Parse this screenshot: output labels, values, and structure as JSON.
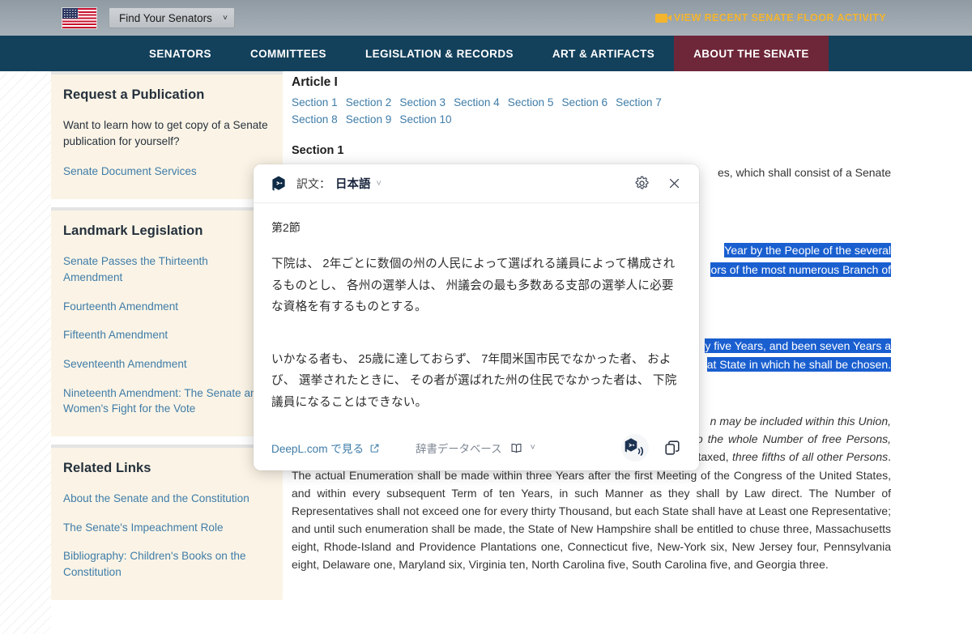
{
  "topbar": {
    "flag_icon": "us-flag-icon",
    "senator_select": {
      "label": "Find Your Senators",
      "chevron": "˅"
    },
    "floor_activity": {
      "label": "VIEW RECENT SENATE FLOOR ACTIVITY",
      "icon": "video-camera-icon"
    }
  },
  "nav": {
    "items": [
      {
        "label": "SENATORS",
        "active": false
      },
      {
        "label": "COMMITTEES",
        "active": false
      },
      {
        "label": "LEGISLATION & RECORDS",
        "active": false
      },
      {
        "label": "ART & ARTIFACTS",
        "active": false
      },
      {
        "label": "ABOUT THE SENATE",
        "active": true
      }
    ],
    "active_color": "#6e2639",
    "bar_color": "#13415c"
  },
  "sidebar": {
    "panels": [
      {
        "title": "Request a Publication",
        "text": "Want to learn how to get copy of a Senate publication for yourself?",
        "links": [
          "Senate Document Services"
        ]
      },
      {
        "title": "Landmark Legislation",
        "links": [
          "Senate Passes the Thirteenth Amendment",
          "Fourteenth Amendment",
          "Fifteenth Amendment",
          "Seventeenth Amendment",
          "Nineteenth Amendment: The Senate and Women's Fight for the Vote"
        ]
      },
      {
        "title": "Related Links",
        "links": [
          "About the Senate and the Constitution",
          "The Senate's Impeachment Role",
          "Bibliography: Children's Books on the Constitution"
        ]
      }
    ],
    "drag_handle": "resize-grip-icon"
  },
  "article": {
    "heading": "Article I",
    "section_links": [
      "Section 1",
      "Section 2",
      "Section 3",
      "Section 4",
      "Section 5",
      "Section 6",
      "Section 7",
      "Section 8",
      "Section 9",
      "Section 10"
    ],
    "section1_heading": "Section 1",
    "section1_tail": "es, which shall consist of a Senate",
    "highlight_1a": "Year by the People of the several",
    "highlight_1b": "ors of the most numerous Branch of",
    "highlight_2a": "y five Years, and been seven Years a",
    "highlight_2b": "at State in which he shall be chosen.",
    "para_tail": "n may be included within this Union,",
    "para_italic_1": "according to their respective Numbers, which shall be determined by adding to the whole Number of free Persons, including those bound to Service for a Term of Years,",
    "para_mid_1": " and excluding Indians not taxed, ",
    "para_italic_2": "three fifths of all other Persons",
    "para_rest": ". The actual Enumeration shall be made within three Years after the first Meeting of the Congress of the United States, and within every subsequent Term of ten Years, in such Manner as they shall by Law direct. The Number of Representatives shall not exceed one for every thirty Thousand, but each State shall have at Least one Representative; and until such enumeration shall be made, the State of New Hampshire shall be entitled to chuse three, Massachusetts eight, Rhode-Island and Providence Plantations one, Connecticut five, New-York six, New Jersey four, Pennsylvania eight, Delaware one, Maryland six, Virginia ten, North Carolina five, South Carolina five, and Georgia three."
  },
  "deepl": {
    "logo_icon": "deepl-logo-icon",
    "label": "訳文：",
    "language": "日本語",
    "language_chevron": "˅",
    "settings_icon": "gear-icon",
    "close_icon": "close-icon",
    "translation_heading": "第2節",
    "translation_p1": "下院は、 2年ごとに数個の州の人民によって選ばれる議員によって構成されるものとし、 各州の選挙人は、 州議会の最も多数ある支部の選挙人に必要な資格を有するものとする。",
    "translation_p2": "いかなる者も、 25歳に達しておらず、 7年間米国市民でなかった者、 および、 選挙されたときに、 その者が選ばれた州の住民でなかった者は、 下院議員になることはできない。",
    "footer_link": "DeepL.com で見る",
    "footer_link_icon": "external-link-icon",
    "dictionary_label": "辞書データベース",
    "dictionary_icon": "book-icon",
    "dictionary_chevron": "˅",
    "speak_icon": "deepl-speak-icon",
    "copy_icon": "copy-icon",
    "accent_color": "#0f2b46",
    "link_color": "#3f7ca8"
  }
}
